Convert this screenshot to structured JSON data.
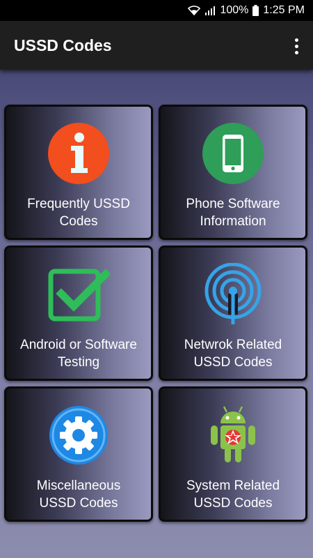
{
  "status": {
    "battery": "100%",
    "time": "1:25 PM"
  },
  "app_bar": {
    "title": "USSD Codes"
  },
  "tiles": [
    {
      "label": "Frequently USSD\nCodes"
    },
    {
      "label": "Phone Software\nInformation"
    },
    {
      "label": "Android or Software\nTesting"
    },
    {
      "label": "Netwrok Related\nUSSD Codes"
    },
    {
      "label": "Miscellaneous\nUSSD Codes"
    },
    {
      "label": "System Related\nUSSD Codes"
    }
  ],
  "colors": {
    "info": "#f24e1e",
    "phone": "#2e9e58",
    "check": "#2ebd59",
    "network": "#35a4e8",
    "gear": "#1e88e5",
    "android": "#8bc34a"
  }
}
